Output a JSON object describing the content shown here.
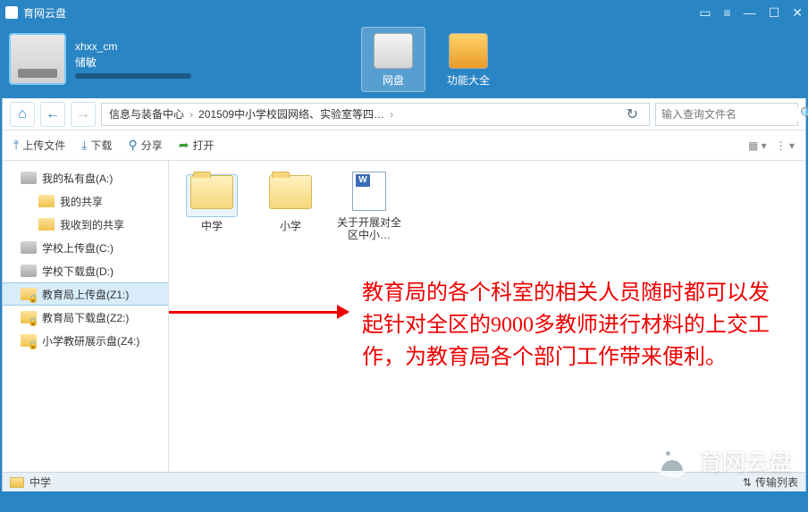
{
  "window": {
    "title": "育网云盘"
  },
  "user": {
    "name": "xhxx_cm",
    "sub": "储敏"
  },
  "tabs": {
    "disk": "网盘",
    "tools": "功能大全"
  },
  "breadcrumb": {
    "seg1": "信息与装备中心",
    "seg2": "201509中小学校园网络、实验室等四…"
  },
  "search": {
    "placeholder": "输入查询文件名"
  },
  "toolbar": {
    "upload": "上传文件",
    "download": "下载",
    "share": "分享",
    "open": "打开"
  },
  "sidebar": {
    "items": [
      {
        "label": "我的私有盘(A:)"
      },
      {
        "label": "我的共享"
      },
      {
        "label": "我收到的共享"
      },
      {
        "label": "学校上传盘(C:)"
      },
      {
        "label": "学校下载盘(D:)"
      },
      {
        "label": "教育局上传盘(Z1:)"
      },
      {
        "label": "教育局下载盘(Z2:)"
      },
      {
        "label": "小学教研展示盘(Z4:)"
      }
    ]
  },
  "files": {
    "items": [
      {
        "label": "中学",
        "type": "folder"
      },
      {
        "label": "小学",
        "type": "folder"
      },
      {
        "label": "关于开展对全区中小…",
        "type": "doc"
      }
    ]
  },
  "annotation": {
    "text": "教育局的各个科室的相关人员随时都可以发起针对全区的9000多教师进行材料的上交工作，为教育局各个部门工作带来便利。"
  },
  "statusbar": {
    "path": "中学",
    "transfer": "传输列表"
  },
  "watermark": {
    "text": "育网云盘"
  }
}
